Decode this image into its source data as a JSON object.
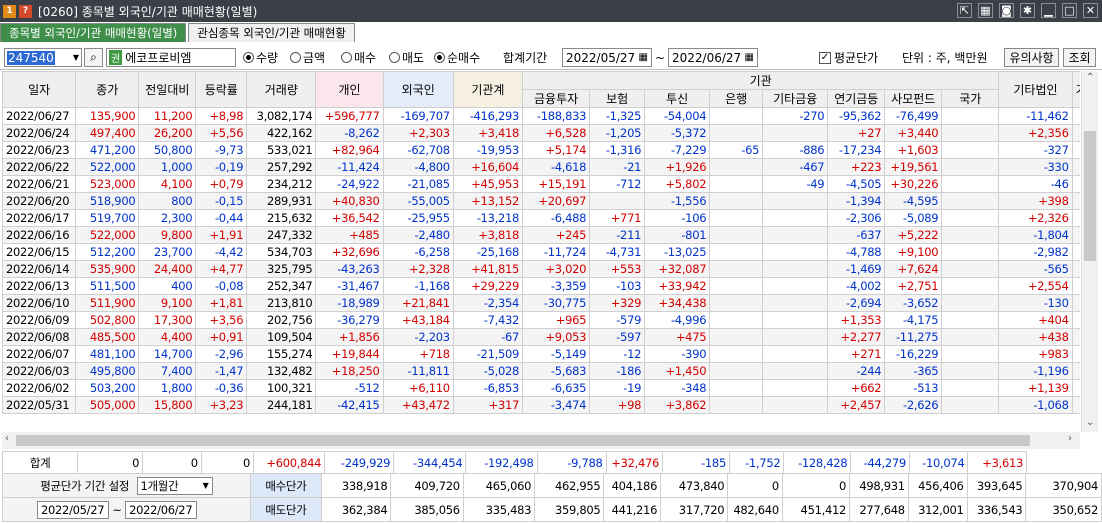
{
  "window": {
    "number_icon": "1",
    "q_icon": "?",
    "title": "[0260] 종목별 외국인/기관 매매현황(일별)"
  },
  "tabs": [
    {
      "label": "종목별 외국인/기관 매매현황(일별)"
    },
    {
      "label": "관심종목 외국인/기관 매매현황"
    }
  ],
  "toolbar": {
    "code": "247540",
    "stock_badge": "권",
    "stock_name": "에코프로비엠",
    "unit_opts": [
      "수량",
      "금액"
    ],
    "unit_selected": "수량",
    "trade_opts": [
      "매수",
      "매도",
      "순매수"
    ],
    "trade_selected": "순매수",
    "period_label": "합계기간",
    "date_from": "2022/05/27",
    "tilde": "~",
    "date_to": "2022/06/27",
    "avg_price_label": "평균단가",
    "avg_checked": "✓",
    "unit_label": "단위 : 주, 백만원",
    "notice_btn": "유의사항",
    "query_btn": "조회"
  },
  "headers": {
    "date": "일자",
    "close": "종가",
    "change": "전일대비",
    "rate": "등락률",
    "volume": "거래량",
    "individual": "개인",
    "foreign": "외국인",
    "inst_total": "기관계",
    "inst_group": "기관",
    "sub": [
      "금융투자",
      "보험",
      "투신",
      "은행",
      "기타금융",
      "연기금등",
      "사모펀드",
      "국가"
    ],
    "other_corp": "기타법인",
    "more": "기"
  },
  "rows": [
    [
      "2022/06/27",
      "135,900",
      "11,200",
      "+8,98",
      "3,082,174",
      "+596,777",
      "-169,707",
      "-416,293",
      "-188,833",
      "-1,325",
      "-54,004",
      "",
      "-270",
      "-95,362",
      "-76,499",
      "",
      "-11,462",
      "u"
    ],
    [
      "2022/06/24",
      "497,400",
      "26,200",
      "+5,56",
      "422,162",
      "-8,262",
      "+2,303",
      "+3,418",
      "+6,528",
      "-1,205",
      "-5,372",
      "",
      "",
      "+27",
      "+3,440",
      "",
      "+2,356",
      "u"
    ],
    [
      "2022/06/23",
      "471,200",
      "50,800",
      "-9,73",
      "533,021",
      "+82,964",
      "-62,708",
      "-19,953",
      "+5,174",
      "-1,316",
      "-7,229",
      "-65",
      "-886",
      "-17,234",
      "+1,603",
      "",
      "-327",
      "d"
    ],
    [
      "2022/06/22",
      "522,000",
      "1,000",
      "-0,19",
      "257,292",
      "-11,424",
      "-4,800",
      "+16,604",
      "-4,618",
      "-21",
      "+1,926",
      "",
      "-467",
      "+223",
      "+19,561",
      "",
      "-330",
      "d"
    ],
    [
      "2022/06/21",
      "523,000",
      "4,100",
      "+0,79",
      "234,212",
      "-24,922",
      "-21,085",
      "+45,953",
      "+15,191",
      "-712",
      "+5,802",
      "",
      "-49",
      "-4,505",
      "+30,226",
      "",
      "-46",
      "u"
    ],
    [
      "2022/06/20",
      "518,900",
      "800",
      "-0,15",
      "289,931",
      "+40,830",
      "-55,005",
      "+13,152",
      "+20,697",
      "",
      "-1,556",
      "",
      "",
      "-1,394",
      "-4,595",
      "",
      "+398",
      "d"
    ],
    [
      "2022/06/17",
      "519,700",
      "2,300",
      "-0,44",
      "215,632",
      "+36,542",
      "-25,955",
      "-13,218",
      "-6,488",
      "+771",
      "-106",
      "",
      "",
      "-2,306",
      "-5,089",
      "",
      "+2,326",
      "d"
    ],
    [
      "2022/06/16",
      "522,000",
      "9,800",
      "+1,91",
      "247,332",
      "+485",
      "-2,480",
      "+3,818",
      "+245",
      "-211",
      "-801",
      "",
      "",
      "-637",
      "+5,222",
      "",
      "-1,804",
      "u"
    ],
    [
      "2022/06/15",
      "512,200",
      "23,700",
      "-4,42",
      "534,703",
      "+32,696",
      "-6,258",
      "-25,168",
      "-11,724",
      "-4,731",
      "-13,025",
      "",
      "",
      "-4,788",
      "+9,100",
      "",
      "-2,982",
      "d"
    ],
    [
      "2022/06/14",
      "535,900",
      "24,400",
      "+4,77",
      "325,795",
      "-43,263",
      "+2,328",
      "+41,815",
      "+3,020",
      "+553",
      "+32,087",
      "",
      "",
      "-1,469",
      "+7,624",
      "",
      "-565",
      "u"
    ],
    [
      "2022/06/13",
      "511,500",
      "400",
      "-0,08",
      "252,347",
      "-31,467",
      "-1,168",
      "+29,229",
      "-3,359",
      "-103",
      "+33,942",
      "",
      "",
      "-4,002",
      "+2,751",
      "",
      "+2,554",
      "d"
    ],
    [
      "2022/06/10",
      "511,900",
      "9,100",
      "+1,81",
      "213,810",
      "-18,989",
      "+21,841",
      "-2,354",
      "-30,775",
      "+329",
      "+34,438",
      "",
      "",
      "-2,694",
      "-3,652",
      "",
      "-130",
      "u"
    ],
    [
      "2022/06/09",
      "502,800",
      "17,300",
      "+3,56",
      "202,756",
      "-36,279",
      "+43,184",
      "-7,432",
      "+965",
      "-579",
      "-4,996",
      "",
      "",
      "+1,353",
      "-4,175",
      "",
      "+404",
      "u"
    ],
    [
      "2022/06/08",
      "485,500",
      "4,400",
      "+0,91",
      "109,504",
      "+1,856",
      "-2,203",
      "-67",
      "+9,053",
      "-597",
      "+475",
      "",
      "",
      "+2,277",
      "-11,275",
      "",
      "+438",
      "u"
    ],
    [
      "2022/06/07",
      "481,100",
      "14,700",
      "-2,96",
      "155,274",
      "+19,844",
      "+718",
      "-21,509",
      "-5,149",
      "-12",
      "-390",
      "",
      "",
      "+271",
      "-16,229",
      "",
      "+983",
      "d"
    ],
    [
      "2022/06/03",
      "495,800",
      "7,400",
      "-1,47",
      "132,482",
      "+18,250",
      "-11,811",
      "-5,028",
      "-5,683",
      "-186",
      "+1,450",
      "",
      "",
      "-244",
      "-365",
      "",
      "-1,196",
      "d"
    ],
    [
      "2022/06/02",
      "503,200",
      "1,800",
      "-0,36",
      "100,321",
      "-512",
      "+6,110",
      "-6,853",
      "-6,635",
      "-19",
      "-348",
      "",
      "",
      "+662",
      "-513",
      "",
      "+1,139",
      "d"
    ],
    [
      "2022/05/31",
      "505,000",
      "15,800",
      "+3,23",
      "244,181",
      "-42,415",
      "+43,472",
      "+317",
      "-3,474",
      "+98",
      "+3,862",
      "",
      "",
      "+2,457",
      "-2,626",
      "",
      "-1,068",
      "u"
    ]
  ],
  "summary": {
    "label": "합계",
    "vals": [
      "0",
      "0",
      "0",
      "+600,844",
      "-249,929",
      "-344,454",
      "-192,498",
      "-9,788",
      "+32,476",
      "-185",
      "-1,752",
      "-128,428",
      "-44,279",
      "-10,074",
      "+3,613"
    ]
  },
  "avg": {
    "period_label": "평균단가 기간 설정",
    "period_value": "1개월간",
    "buy_label": "매수단가",
    "sell_label": "매도단가",
    "date_from": "2022/05/27",
    "tilde": "~",
    "date_to": "2022/06/27",
    "buy": [
      "338,918",
      "409,720",
      "465,060",
      "462,955",
      "404,186",
      "473,840",
      "0",
      "0",
      "498,931",
      "456,406",
      "393,645",
      "370,904"
    ],
    "sell": [
      "362,384",
      "385,056",
      "335,483",
      "359,805",
      "441,216",
      "317,720",
      "482,640",
      "451,412",
      "277,648",
      "312,001",
      "336,543",
      "350,652"
    ]
  },
  "colors": {
    "up": "#d40000",
    "down": "#0033cc",
    "title_bg": "#3a3f48",
    "tab_active": "#3f8f4a"
  }
}
